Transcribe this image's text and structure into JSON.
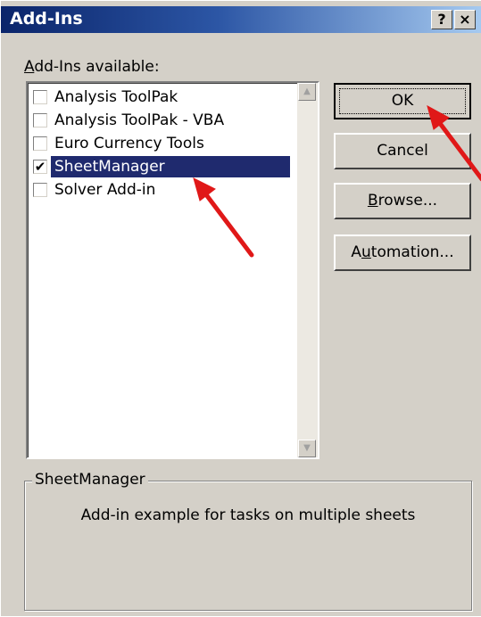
{
  "window": {
    "title": "Add-Ins",
    "help_label": "?",
    "close_label": "×"
  },
  "list": {
    "label_prefix": "A",
    "label_rest": "dd-Ins available:",
    "items": [
      {
        "label": "Analysis ToolPak",
        "checked": false,
        "selected": false
      },
      {
        "label": "Analysis ToolPak - VBA",
        "checked": false,
        "selected": false
      },
      {
        "label": "Euro Currency Tools",
        "checked": false,
        "selected": false
      },
      {
        "label": "SheetManager",
        "checked": true,
        "selected": true
      },
      {
        "label": "Solver Add-in",
        "checked": false,
        "selected": false
      }
    ],
    "check_glyph": "✔"
  },
  "buttons": {
    "ok": "OK",
    "cancel": "Cancel",
    "browse_mnemonic": "B",
    "browse_rest": "rowse...",
    "automation_pre": "A",
    "automation_mnemonic": "u",
    "automation_rest": "tomation..."
  },
  "description": {
    "title": "SheetManager",
    "text": "Add-in example for tasks on multiple sheets"
  },
  "annotations": {
    "arrow_color": "#e01818"
  }
}
